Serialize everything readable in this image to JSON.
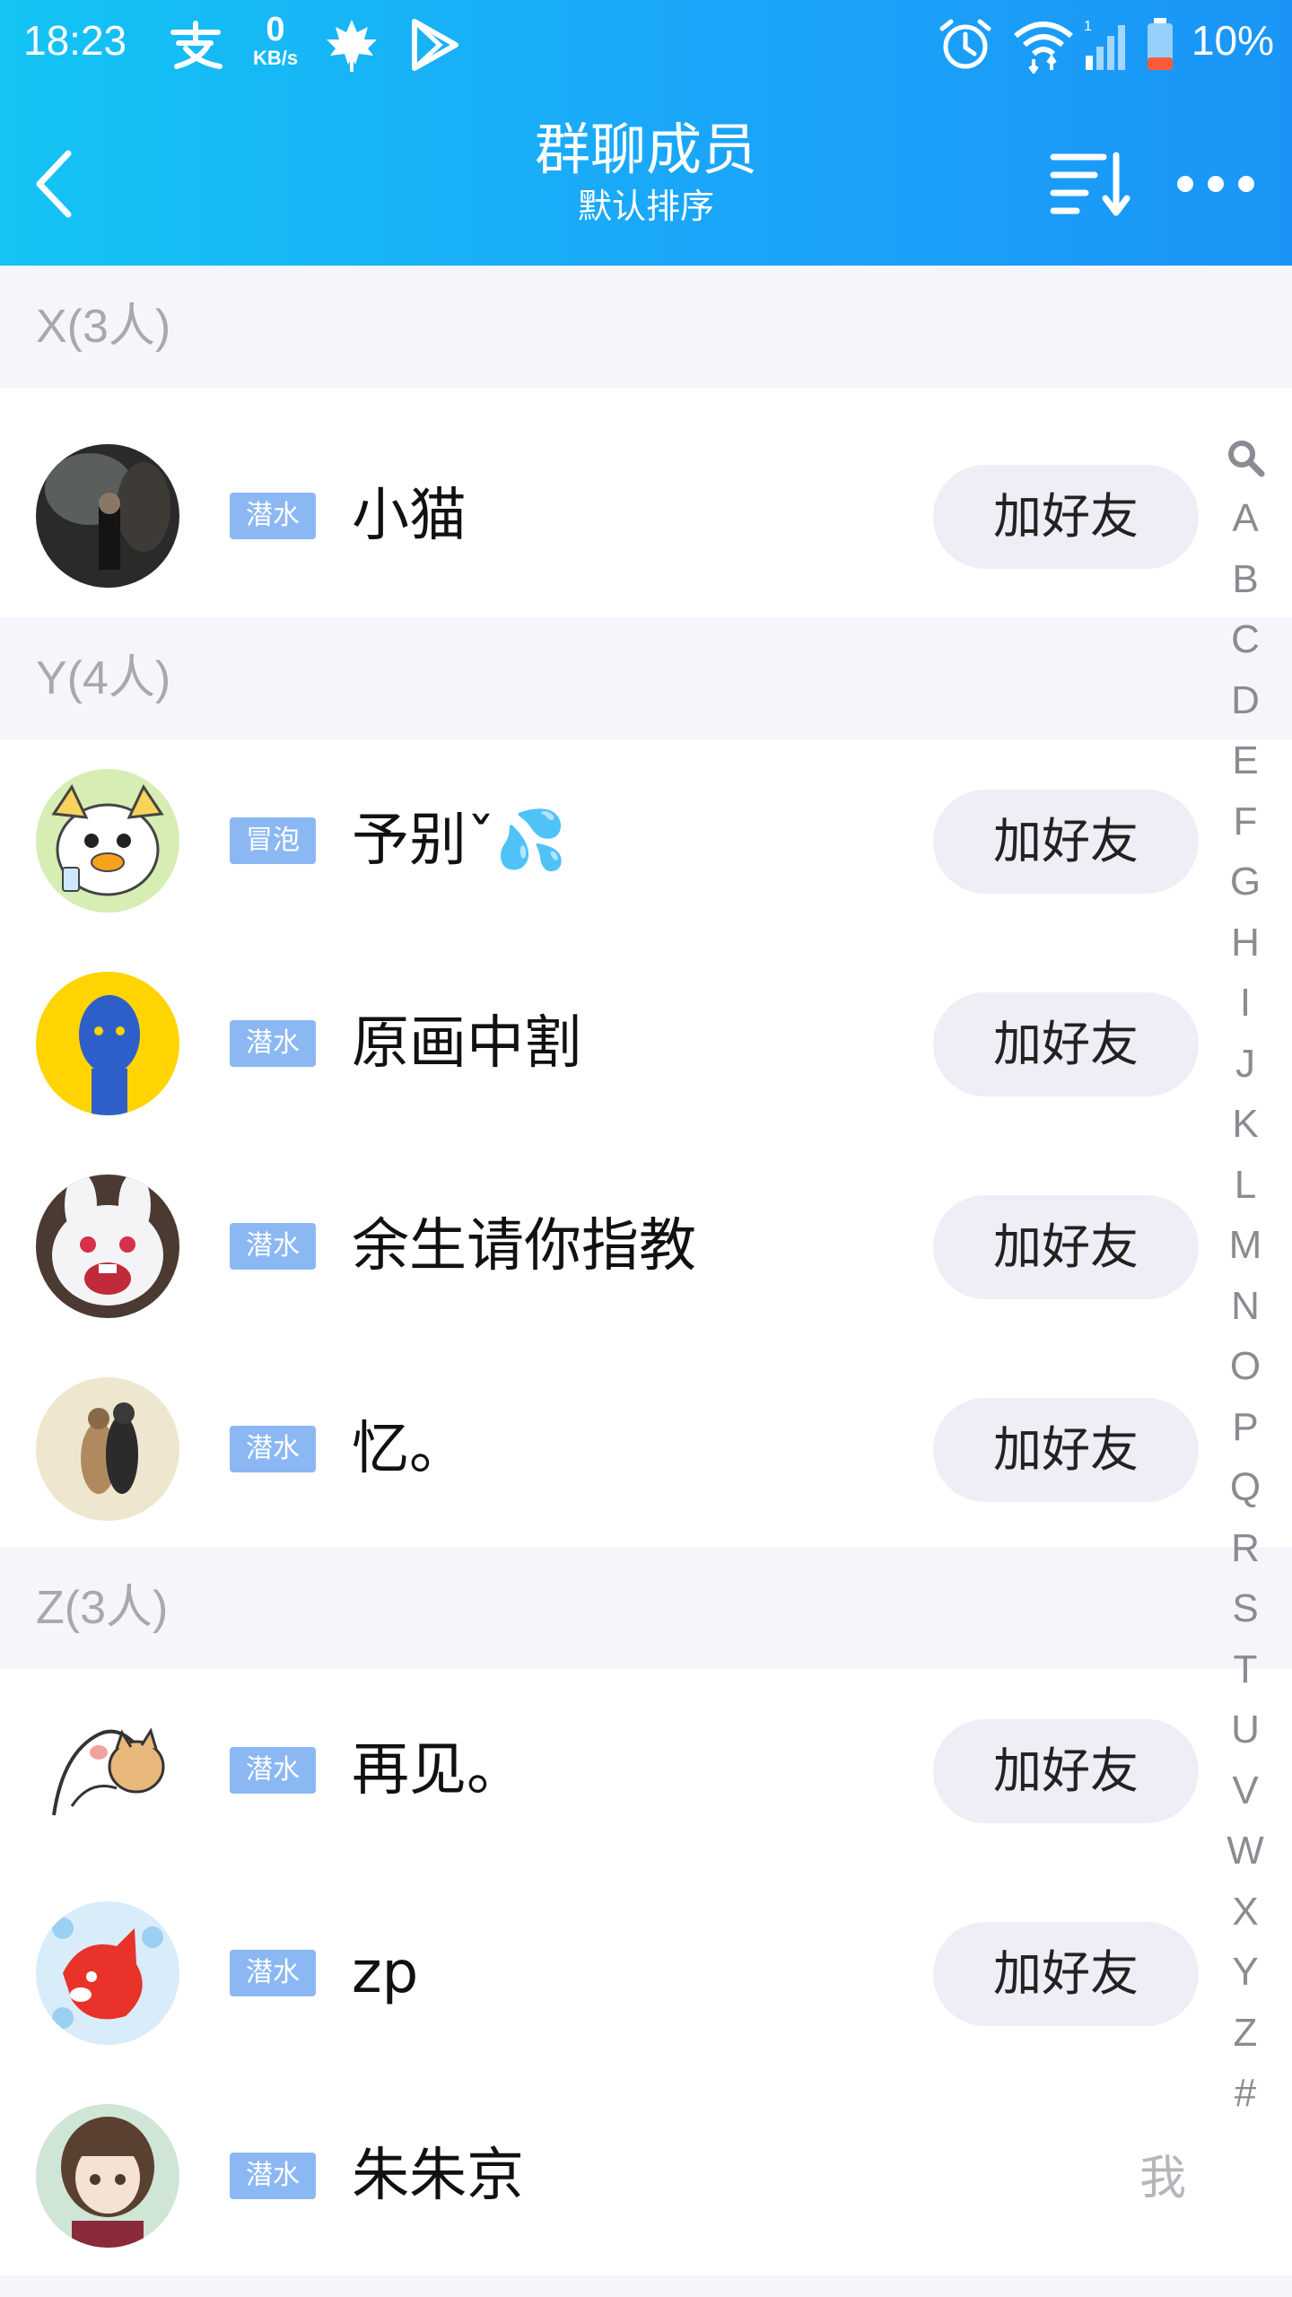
{
  "status_bar": {
    "time": "18:23",
    "speed_value": "0",
    "speed_unit": "KB/s",
    "battery_percent": "10%",
    "icons": [
      "alipay-icon",
      "speed-icon",
      "leaf-icon",
      "play-store-icon",
      "alarm-icon",
      "wifi-icon",
      "signal-icon",
      "battery-icon"
    ]
  },
  "title_bar": {
    "title": "群聊成员",
    "subtitle": "默认排序",
    "back_icon": "chevron-left-icon",
    "sort_icon": "sort-icon",
    "more_icon": "more-dots-icon"
  },
  "colors": {
    "header_gradient_start": "#13c4f4",
    "header_gradient_end": "#1a95f7",
    "badge": "#8bb8f2",
    "section_bg": "#f5f6fb",
    "button_bg": "#eeeff6"
  },
  "sections": [
    {
      "header": "X(3人)",
      "members": [
        {
          "name": "小猫",
          "role": "潜水",
          "action": "加好友",
          "avatar": "dark-photo-avatar"
        }
      ]
    },
    {
      "header": "Y(4人)",
      "members": [
        {
          "name": "予别ˇ💦",
          "role": "冒泡",
          "action": "加好友",
          "avatar": "cartoon-bird-avatar"
        },
        {
          "name": "原画中割",
          "role": "潜水",
          "action": "加好友",
          "avatar": "blue-face-avatar"
        },
        {
          "name": "余生请你指教",
          "role": "潜水",
          "action": "加好友",
          "avatar": "white-rabbit-avatar"
        },
        {
          "name": "忆。",
          "role": "潜水",
          "action": "加好友",
          "avatar": "couple-photo-avatar"
        }
      ]
    },
    {
      "header": "Z(3人)",
      "members": [
        {
          "name": "再见。",
          "role": "潜水",
          "action": "加好友",
          "avatar": "sketch-cat-avatar"
        },
        {
          "name": "zp",
          "role": "潜水",
          "action": "加好友",
          "avatar": "red-fox-avatar"
        },
        {
          "name": "朱朱京",
          "role": "潜水",
          "self_label": "我",
          "avatar": "anime-girl-avatar"
        }
      ]
    }
  ],
  "alphabet_index": {
    "search_icon": "search-icon",
    "letters": [
      "A",
      "B",
      "C",
      "D",
      "E",
      "F",
      "G",
      "H",
      "I",
      "J",
      "K",
      "L",
      "M",
      "N",
      "O",
      "P",
      "Q",
      "R",
      "S",
      "T",
      "U",
      "V",
      "W",
      "X",
      "Y",
      "Z",
      "#"
    ]
  }
}
